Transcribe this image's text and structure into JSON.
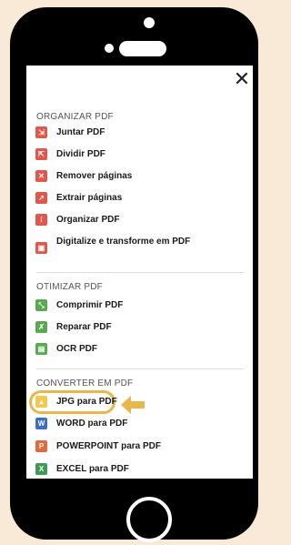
{
  "close_icon": "close-icon",
  "sections": [
    {
      "title": "ORGANIZAR PDF",
      "items": [
        {
          "label": "Juntar PDF",
          "icon": "merge-icon",
          "color": "#e2574c"
        },
        {
          "label": "Dividir PDF",
          "icon": "split-icon",
          "color": "#e2574c"
        },
        {
          "label": "Remover páginas",
          "icon": "remove-pages-icon",
          "color": "#e2574c"
        },
        {
          "label": "Extrair páginas",
          "icon": "extract-pages-icon",
          "color": "#e2574c"
        },
        {
          "label": "Organizar PDF",
          "icon": "organize-icon",
          "color": "#e2574c"
        },
        {
          "label": "Digitalize e transforme em PDF",
          "icon": "scan-icon",
          "color": "#e2574c"
        }
      ]
    },
    {
      "title": "OTIMIZAR PDF",
      "items": [
        {
          "label": "Comprimir PDF",
          "icon": "compress-icon",
          "color": "#5aa84f"
        },
        {
          "label": "Reparar PDF",
          "icon": "repair-icon",
          "color": "#5aa84f"
        },
        {
          "label": "OCR PDF",
          "icon": "ocr-icon",
          "color": "#5aa84f"
        }
      ]
    },
    {
      "title": "CONVERTER EM PDF",
      "items": [
        {
          "label": "JPG para PDF",
          "icon": "jpg-icon",
          "color": "#f2c94c"
        },
        {
          "label": "WORD para PDF",
          "icon": "word-icon",
          "color": "#3b6fc4"
        },
        {
          "label": "POWERPOINT para PDF",
          "icon": "powerpoint-icon",
          "color": "#e06a3b"
        },
        {
          "label": "EXCEL para PDF",
          "icon": "excel-icon",
          "color": "#3f9a55"
        }
      ]
    }
  ],
  "highlight_color": "#e9b64a",
  "background_color": "#f8ead6"
}
